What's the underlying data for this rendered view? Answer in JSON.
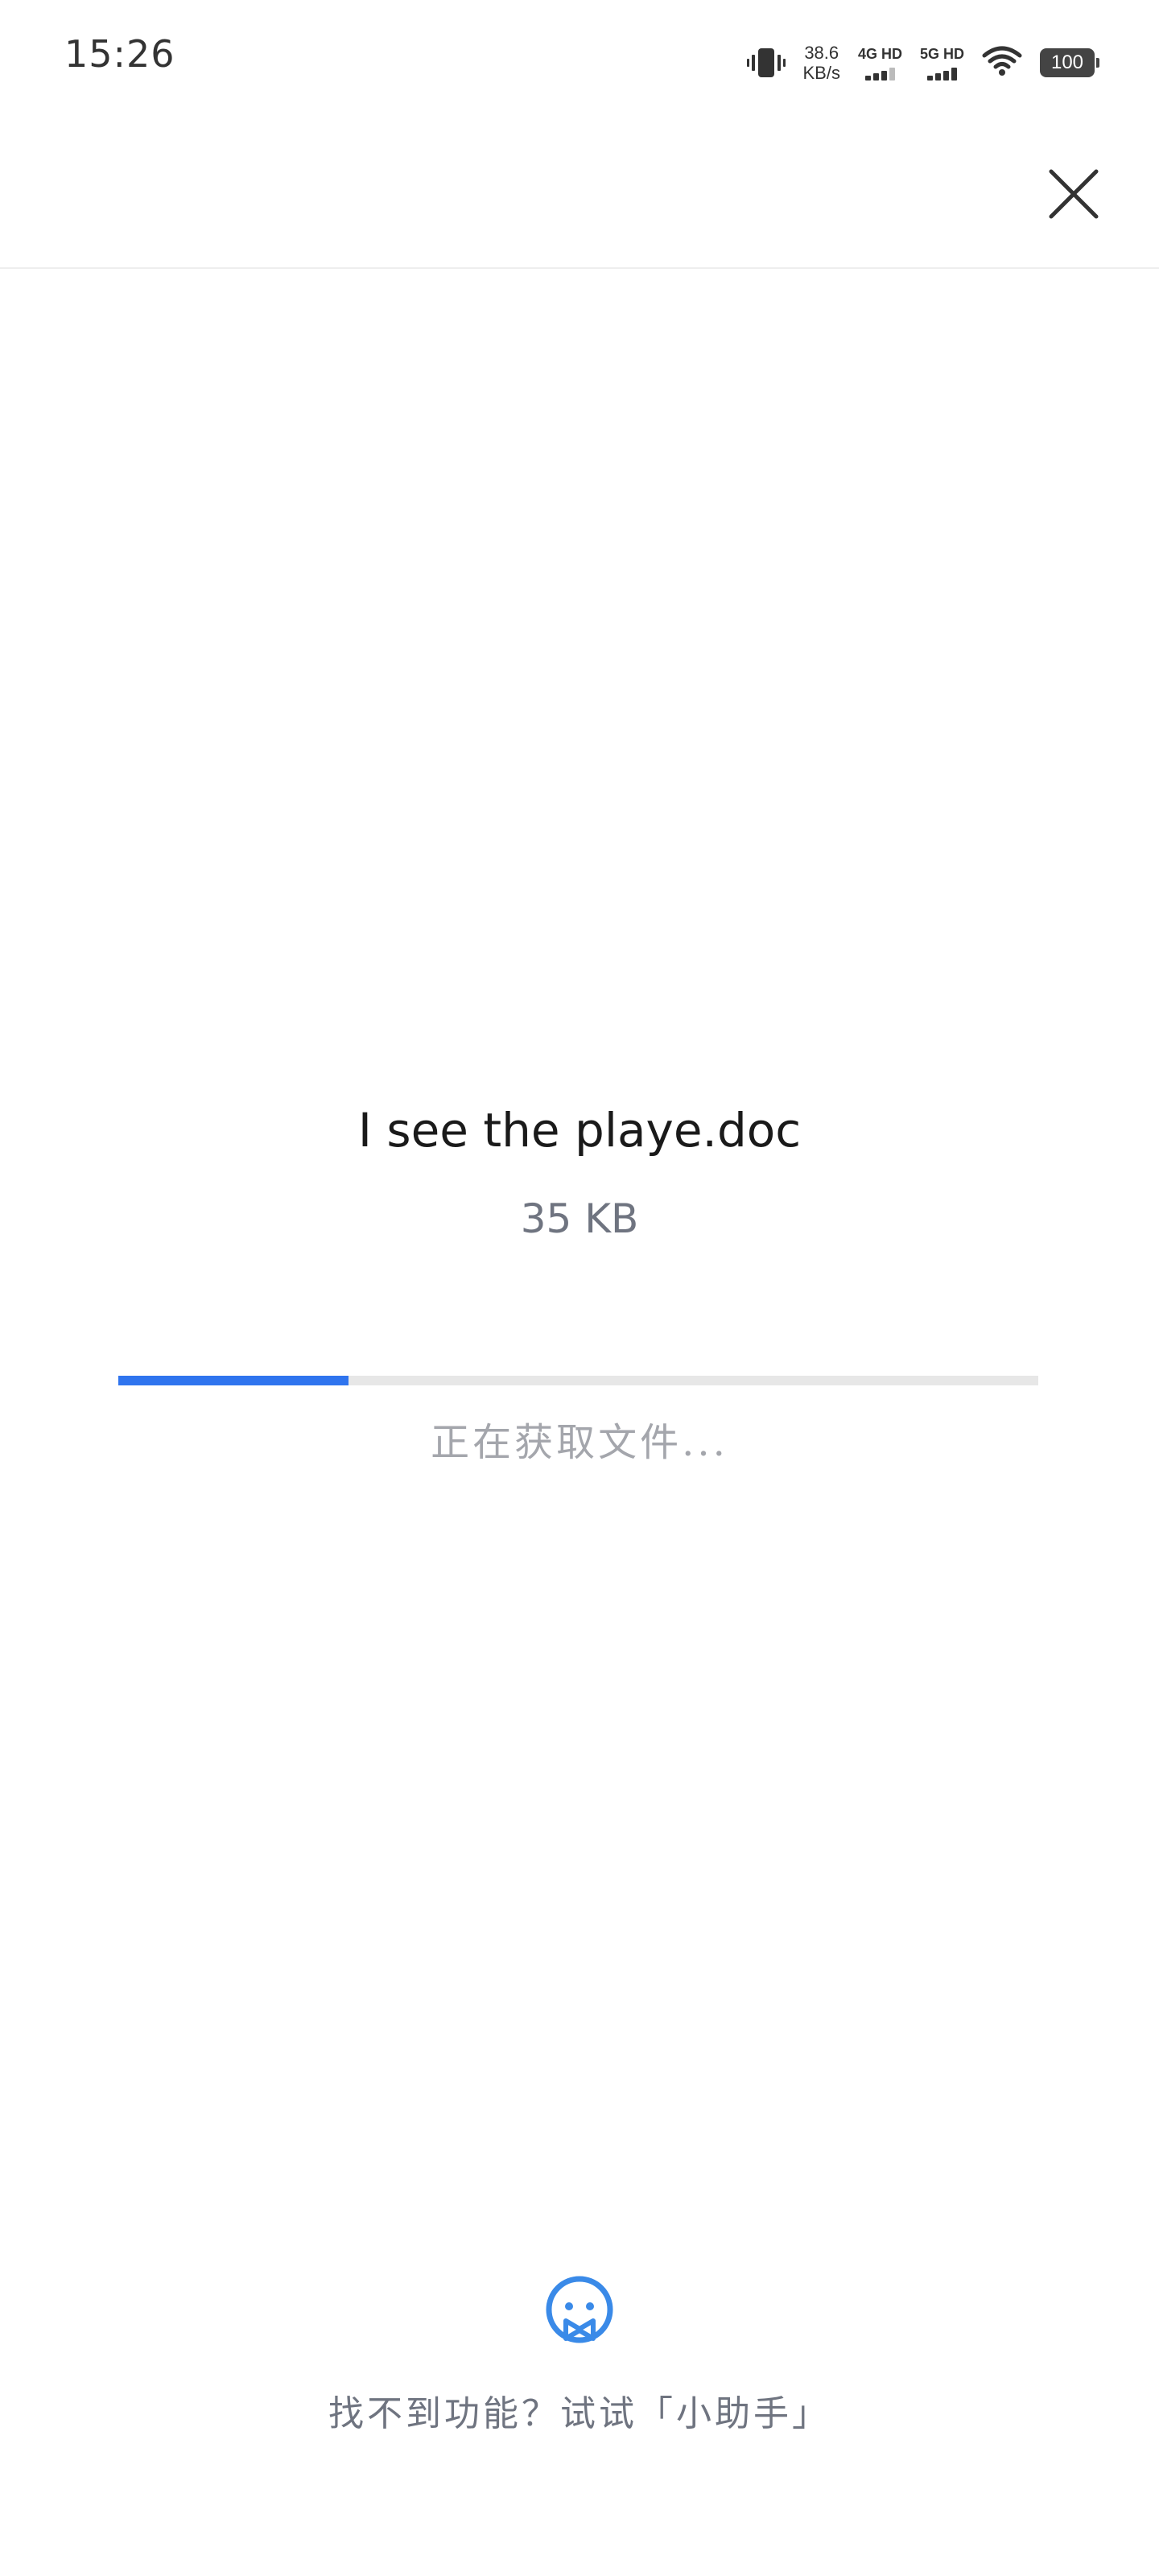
{
  "status_bar": {
    "time": "15:26",
    "net_speed_value": "38.6",
    "net_speed_unit": "KB/s",
    "sim1_label": "4G HD",
    "sim2_label": "5G HD",
    "battery": "100"
  },
  "file": {
    "name": "I see the playe.doc",
    "size": "35 KB"
  },
  "progress": {
    "fraction": 0.25,
    "status_text": "正在获取文件..."
  },
  "assistant": {
    "prompt_text": "找不到功能？试试「小助手」"
  },
  "colors": {
    "accent": "#2f74ee",
    "track": "#e7e7e7",
    "muted_text": "#6f7480",
    "status_text": "#a4a6ac"
  }
}
